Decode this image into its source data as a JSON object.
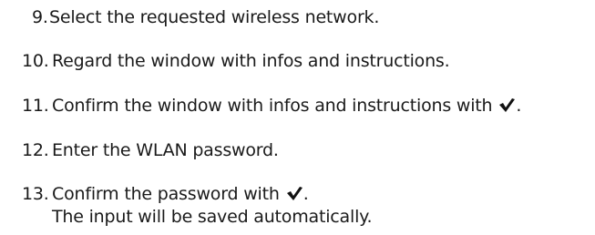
{
  "steps": [
    {
      "number": "9.",
      "text": "Select the requested wireless network."
    },
    {
      "number": "10.",
      "text": "Regard the window with infos and instructions."
    },
    {
      "number": "11.",
      "text": "Confirm the window with infos and instructions with",
      "icon": "checkmark-icon",
      "after": "."
    },
    {
      "number": "12.",
      "text": "Enter the WLAN password."
    },
    {
      "number": "13.",
      "text": "Confirm the password with",
      "icon": "checkmark-icon",
      "after": ".",
      "note": "The input will be saved automatically."
    }
  ]
}
